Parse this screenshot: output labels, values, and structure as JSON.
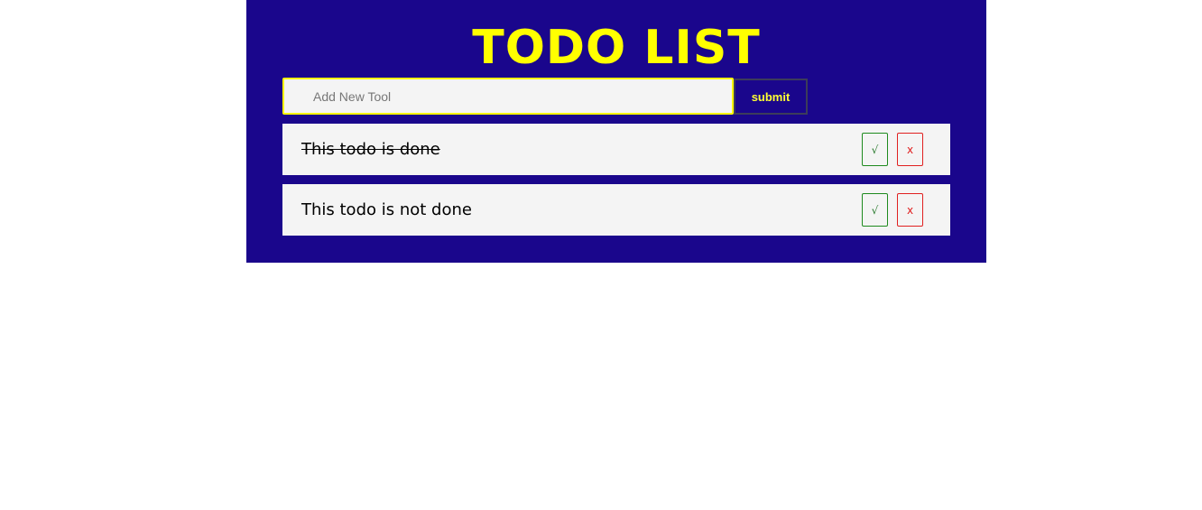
{
  "app": {
    "title": "TODO LIST",
    "background_color": "#1a068c",
    "accent_color": "#ffff00"
  },
  "input": {
    "value": "",
    "placeholder": "Add New Tool"
  },
  "submit": {
    "label": "submit"
  },
  "todos": [
    {
      "text": "This todo is done",
      "done": true,
      "complete_label": "√",
      "delete_label": "x"
    },
    {
      "text": "This todo is not done",
      "done": false,
      "complete_label": "√",
      "delete_label": "x"
    }
  ]
}
